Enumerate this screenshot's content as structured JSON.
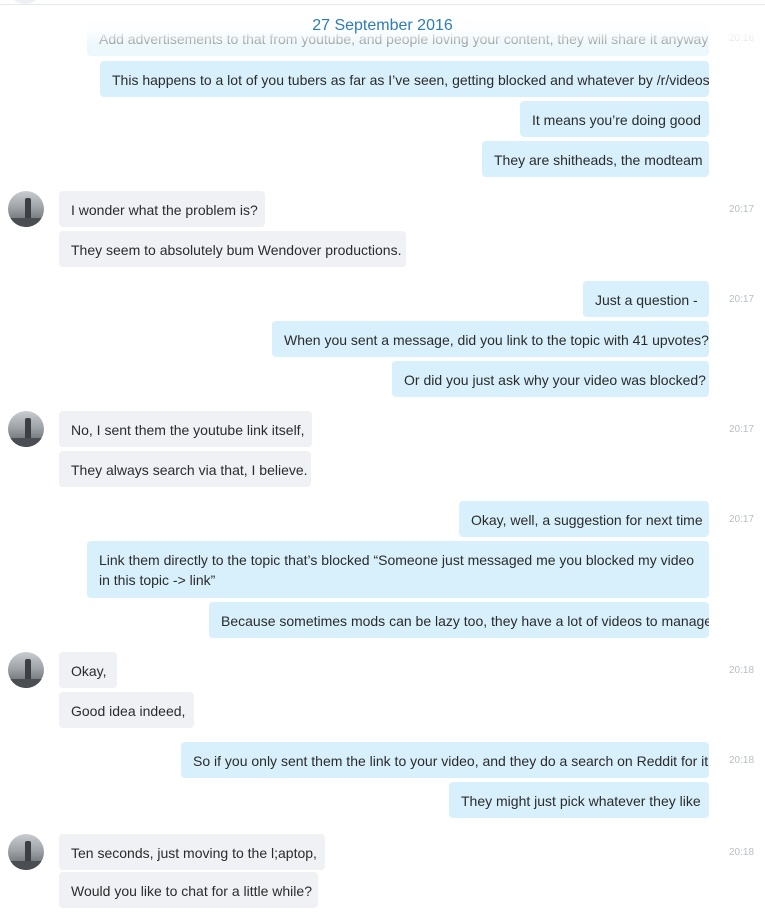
{
  "date_header": "27 September 2016",
  "messages": [
    {
      "dir": "out",
      "text": "Add advertisements to that from youtube, and people loving your content, they will share it anyway",
      "time": "20:16",
      "faded": true
    },
    {
      "dir": "out",
      "text": "This happens to a lot of you tubers as far as I’ve seen, getting blocked and whatever by /r/videos"
    },
    {
      "dir": "out",
      "text": "It means you’re doing good"
    },
    {
      "dir": "out",
      "text": "They are shitheads, the modteam"
    },
    {
      "dir": "in",
      "text": "I wonder what the problem is?",
      "time": "20:17",
      "avatar": true,
      "tail": true
    },
    {
      "dir": "in",
      "text": "They seem to absolutely bum Wendover productions."
    },
    {
      "dir": "out",
      "text": "Just a question -",
      "time": "20:17",
      "tail": true
    },
    {
      "dir": "out",
      "text": "When you sent a message, did you link to the topic with 41 upvotes?"
    },
    {
      "dir": "out",
      "text": "Or did you just ask why your video was blocked?"
    },
    {
      "dir": "in",
      "text": "No, I sent them the youtube link itself,",
      "time": "20:17",
      "avatar": true,
      "tail": true
    },
    {
      "dir": "in",
      "text": "They always search via that, I believe."
    },
    {
      "dir": "out",
      "text": "Okay, well, a suggestion for next time",
      "time": "20:17",
      "tail": true
    },
    {
      "dir": "out",
      "text": "Link them directly to the topic that’s blocked “Someone just messaged me you blocked my video in this topic -> link”",
      "multi": true
    },
    {
      "dir": "out",
      "text": "Because sometimes mods can be lazy too, they have a lot of videos to manage"
    },
    {
      "dir": "in",
      "text": "Okay,",
      "time": "20:18",
      "avatar": true,
      "tail": true
    },
    {
      "dir": "in",
      "text": "Good idea indeed,"
    },
    {
      "dir": "out",
      "text": "So if you only sent them the link to your video, and they do a search on Reddit for it",
      "time": "20:18",
      "tail": true
    },
    {
      "dir": "out",
      "text": "They might just pick whatever they like"
    },
    {
      "dir": "in",
      "text": "Ten seconds, just moving to the l;aptop,",
      "time": "20:18",
      "avatar": true,
      "tail": true
    },
    {
      "dir": "in",
      "text": "Would you like to chat for a little while?"
    }
  ]
}
